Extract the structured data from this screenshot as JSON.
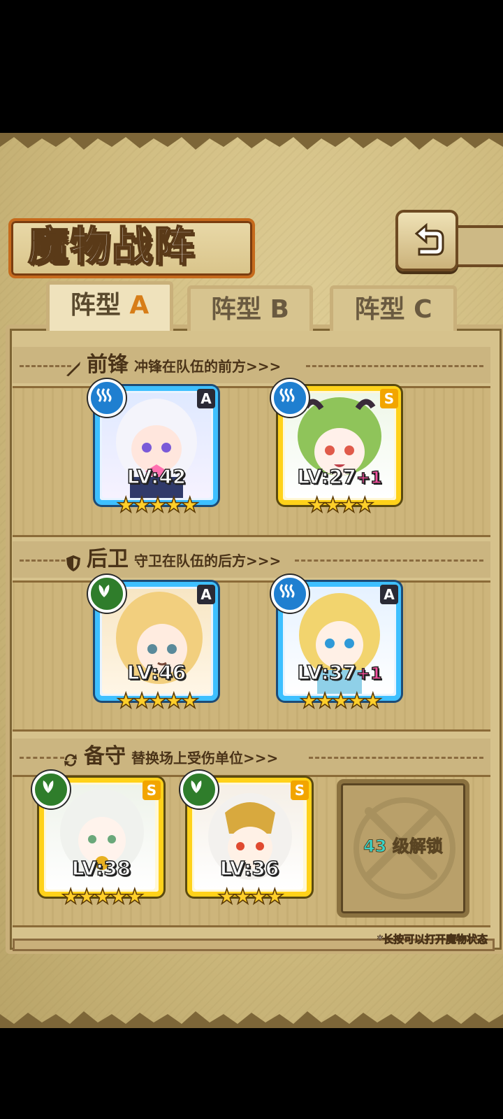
{
  "title": "魔物战阵",
  "tabs": [
    {
      "label": "阵型",
      "letter": "A",
      "active": true
    },
    {
      "label": "阵型",
      "letter": "B",
      "active": false
    },
    {
      "label": "阵型",
      "letter": "C",
      "active": false
    }
  ],
  "sections": {
    "front": {
      "heading": "前锋",
      "desc": "冲锋在队伍的前方>>>"
    },
    "back": {
      "heading": "后卫",
      "desc": "守卫在队伍的后方>>>"
    },
    "reserve": {
      "heading": "备守",
      "desc": "替换场上受伤单位>>>"
    }
  },
  "cards": {
    "front1": {
      "grade": "A",
      "level": "LV:42",
      "plus": "",
      "stars": "★★★★★",
      "element": "water-icon"
    },
    "front2": {
      "grade": "S",
      "level": "LV:27",
      "plus": "+1",
      "stars": "★★★★",
      "element": "water-icon"
    },
    "back1": {
      "grade": "A",
      "level": "LV:46",
      "plus": "",
      "stars": "★★★★★",
      "element": "wind-icon"
    },
    "back2": {
      "grade": "A",
      "level": "LV:37",
      "plus": "+1",
      "stars": "★★★★★",
      "element": "water-icon"
    },
    "res1": {
      "grade": "S",
      "level": "LV:38",
      "plus": "",
      "stars": "★★★★★",
      "element": "wind-icon"
    },
    "res2": {
      "grade": "S",
      "level": "LV:36",
      "plus": "",
      "stars": "★★★★",
      "element": "wind-icon"
    }
  },
  "locked_slot": {
    "level": "43",
    "text": "级解锁"
  },
  "hint": "*长按可以打开魔物状态",
  "colors": {
    "accent": "#d77d18",
    "water": "#1f7fd0",
    "wind": "#2f7d2b",
    "rank_a": "#3ec0ff",
    "rank_s": "#ffd21a"
  }
}
